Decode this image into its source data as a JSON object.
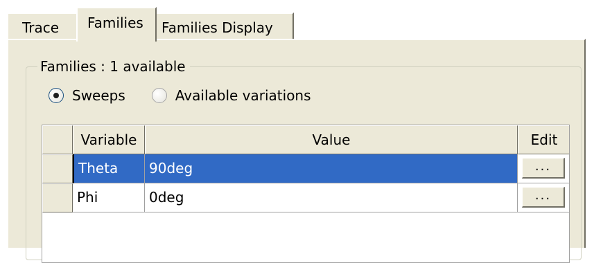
{
  "tabs": [
    {
      "label": "Trace",
      "active": false
    },
    {
      "label": "Families",
      "active": true
    },
    {
      "label": "Families Display",
      "active": false
    }
  ],
  "group": {
    "title": "Families : 1 available",
    "radio_options": [
      {
        "label": "Sweeps",
        "selected": true
      },
      {
        "label": "Available variations",
        "selected": false
      }
    ]
  },
  "grid": {
    "columns": [
      "Variable",
      "Value",
      "Edit"
    ],
    "rows": [
      {
        "variable": "Theta",
        "value": "90deg",
        "edit": "...",
        "selected": true
      },
      {
        "variable": "Phi",
        "value": "0deg",
        "edit": "...",
        "selected": false
      }
    ]
  },
  "colors": {
    "selection": "#316ac5",
    "dialog_face": "#ece9d8"
  }
}
